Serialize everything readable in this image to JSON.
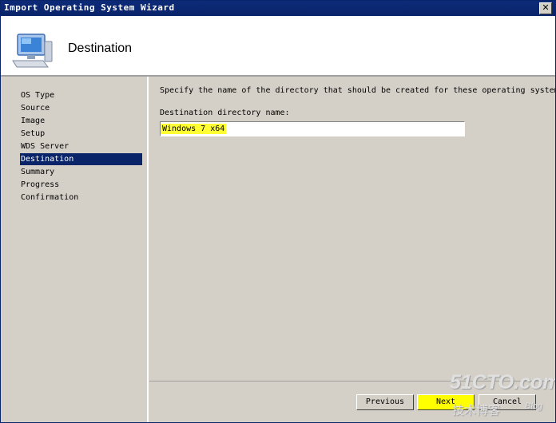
{
  "window": {
    "title": "Import Operating System Wizard",
    "close_glyph": "✕"
  },
  "header": {
    "title": "Destination",
    "icon": "computer-icon"
  },
  "sidebar": {
    "items": [
      {
        "label": "OS Type",
        "active": false
      },
      {
        "label": "Source",
        "active": false
      },
      {
        "label": "Image",
        "active": false
      },
      {
        "label": "Setup",
        "active": false
      },
      {
        "label": "WDS Server",
        "active": false
      },
      {
        "label": "Destination",
        "active": true
      },
      {
        "label": "Summary",
        "active": false
      },
      {
        "label": "Progress",
        "active": false
      },
      {
        "label": "Confirmation",
        "active": false
      }
    ]
  },
  "main": {
    "instruction": "Specify the name of the directory that should be created for these operating system fi",
    "field_label": "Destination directory name:",
    "field_value": "Windows 7 x64"
  },
  "buttons": {
    "previous": "Previous",
    "next": "Next",
    "cancel": "Cancel"
  },
  "watermark": {
    "main": "51CTO.com",
    "sub": "技术博客",
    "blog": "Blog"
  }
}
